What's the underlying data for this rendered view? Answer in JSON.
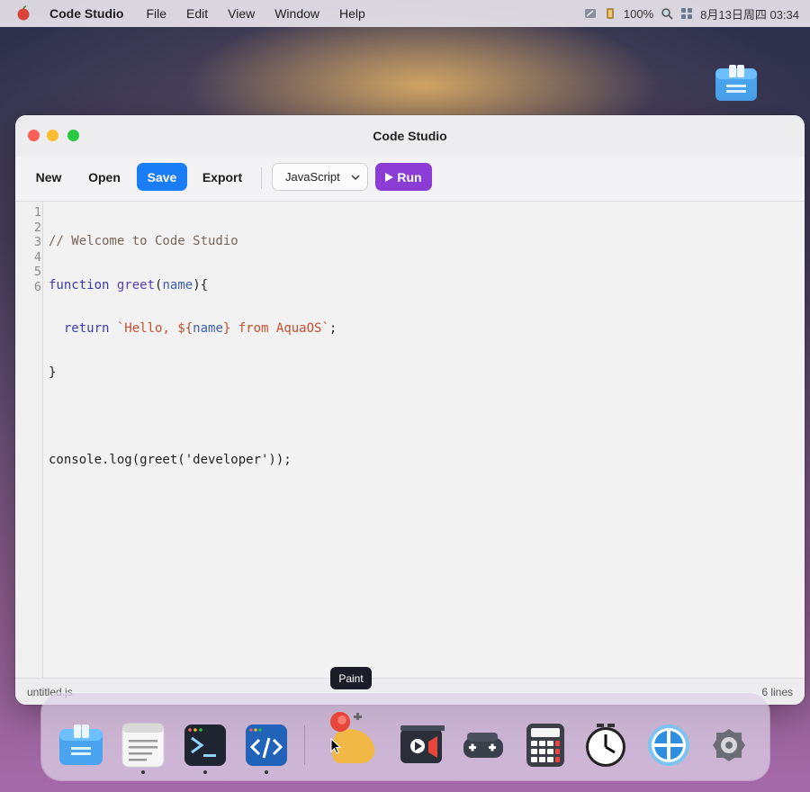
{
  "menubar": {
    "app_name": "Code Studio",
    "items": [
      "File",
      "Edit",
      "View",
      "Window",
      "Help"
    ],
    "battery": "100%",
    "datetime": "8月13日周四 03:34"
  },
  "window": {
    "title": "Code Studio"
  },
  "toolbar": {
    "new_label": "New",
    "open_label": "Open",
    "save_label": "Save",
    "export_label": "Export",
    "language_selected": "JavaScript",
    "run_label": "Run"
  },
  "editor": {
    "line_numbers": [
      "1",
      "2",
      "3",
      "4",
      "5",
      "6"
    ],
    "lines": [
      "// Welcome to Code Studio",
      "function greet(name){",
      "  return `Hello, ${name} from AquaOS`;",
      "}",
      "",
      "console.log(greet('developer'));"
    ]
  },
  "statusbar": {
    "filename": "untitled.js",
    "line_count": "6 lines"
  },
  "tooltip": {
    "text": "Paint"
  },
  "dock": {
    "apps": [
      "finder-icon",
      "notes-icon",
      "terminal-icon",
      "code-studio-icon",
      "paint-icon",
      "video-icon",
      "game-icon",
      "calculator-icon",
      "clock-icon",
      "browser-icon",
      "settings-icon"
    ]
  }
}
